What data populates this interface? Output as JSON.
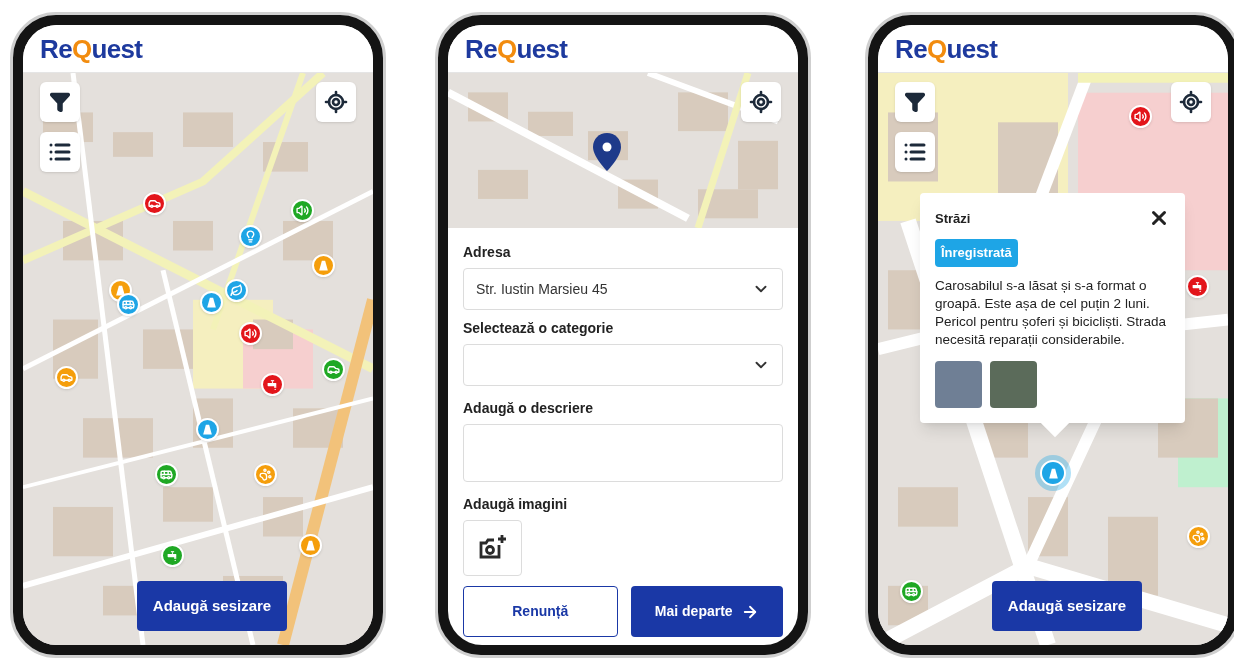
{
  "screens": [
    {
      "kind": "map",
      "logo": {
        "start": "Re",
        "mark": "Q",
        "end": "uest"
      },
      "markers": [
        {
          "kind": "car",
          "color": "#e3151b"
        },
        {
          "kind": "speaker",
          "color": "#1fa824"
        },
        {
          "kind": "bulb",
          "color": "#1ea5e6"
        },
        {
          "kind": "road",
          "color": "#f59e0b"
        },
        {
          "kind": "road",
          "color": "#f59e0b"
        },
        {
          "kind": "bus",
          "color": "#1ea5e6"
        },
        {
          "kind": "leaf",
          "color": "#1ea5e6"
        },
        {
          "kind": "road",
          "color": "#1ea5e6"
        },
        {
          "kind": "speaker",
          "color": "#e3151b"
        },
        {
          "kind": "car",
          "color": "#1fa824"
        },
        {
          "kind": "tap",
          "color": "#e3151b"
        },
        {
          "kind": "car",
          "color": "#f59e0b"
        },
        {
          "kind": "road",
          "color": "#1ea5e6"
        },
        {
          "kind": "bus",
          "color": "#1fa824"
        },
        {
          "kind": "paw",
          "color": "#f59e0b"
        },
        {
          "kind": "tap",
          "color": "#1fa824"
        },
        {
          "kind": "road",
          "color": "#f59e0b"
        }
      ],
      "add_button": "Adaugă sesizare"
    },
    {
      "kind": "form",
      "logo": {
        "start": "Re",
        "mark": "Q",
        "end": "uest"
      },
      "address": {
        "label": "Adresa",
        "value": "Str. Iustin Marsieu 45"
      },
      "category": {
        "label": "Selectează o categorie"
      },
      "description": {
        "label": "Adaugă o descriere"
      },
      "images": {
        "label": "Adaugă imagini"
      },
      "cancel_button": "Renunță",
      "next_button": "Mai departe"
    },
    {
      "kind": "detail",
      "logo": {
        "start": "Re",
        "mark": "Q",
        "end": "uest"
      },
      "markers": [
        {
          "kind": "speaker",
          "color": "#e3151b",
          "selected": false
        },
        {
          "kind": "tap",
          "color": "#e3151b",
          "selected": false
        },
        {
          "kind": "road",
          "color": "#1ea5e6",
          "selected": true
        },
        {
          "kind": "paw",
          "color": "#f59e0b",
          "selected": false
        },
        {
          "kind": "bus",
          "color": "#1fa824",
          "selected": false
        }
      ],
      "popup": {
        "title": "Străzi",
        "status": "Înregistrată",
        "description": "Carosabilul s-a lăsat și s-a format o groapă. Este așa de cel puțin 2 luni. Pericol pentru șoferi și bicicliști. Strada necesită reparații considerabile.",
        "photos": [
          {
            "kind": "photo"
          },
          {
            "kind": "photo"
          }
        ]
      },
      "add_button": "Adaugă sesizare"
    }
  ]
}
